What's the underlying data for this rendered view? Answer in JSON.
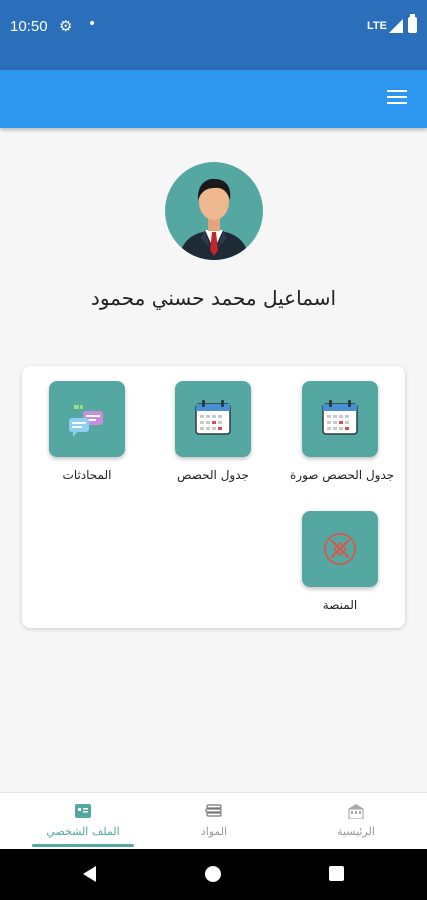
{
  "status_bar": {
    "time": "10:50",
    "gear_icon": "⚙",
    "dot": "•",
    "network": "LTE"
  },
  "app_bar": {
    "menu_icon": "hamburger-menu-icon",
    "background": "#2d97f0"
  },
  "profile": {
    "name": "اسماعيل محمد حسني محمود"
  },
  "menu_tiles": [
    {
      "label": "جدول الحصص صورة",
      "icon": "calendar-icon"
    },
    {
      "label": "جدول الحصص",
      "icon": "calendar-icon"
    },
    {
      "label": "المحادثات",
      "icon": "chat-bubbles-icon"
    },
    {
      "label": "المنصة",
      "icon": "platform-icon"
    }
  ],
  "bottom_nav": {
    "items": [
      {
        "label": "الرئيسية",
        "icon": "home-building-icon"
      },
      {
        "label": "المواد",
        "icon": "books-icon"
      },
      {
        "label": "الملف الشخصي",
        "icon": "profile-card-icon"
      }
    ],
    "active": "الملف الشخصي"
  },
  "colors": {
    "status_bar": "#2b6fba",
    "accent": "#55a7a1",
    "background": "#f6f6f6"
  }
}
